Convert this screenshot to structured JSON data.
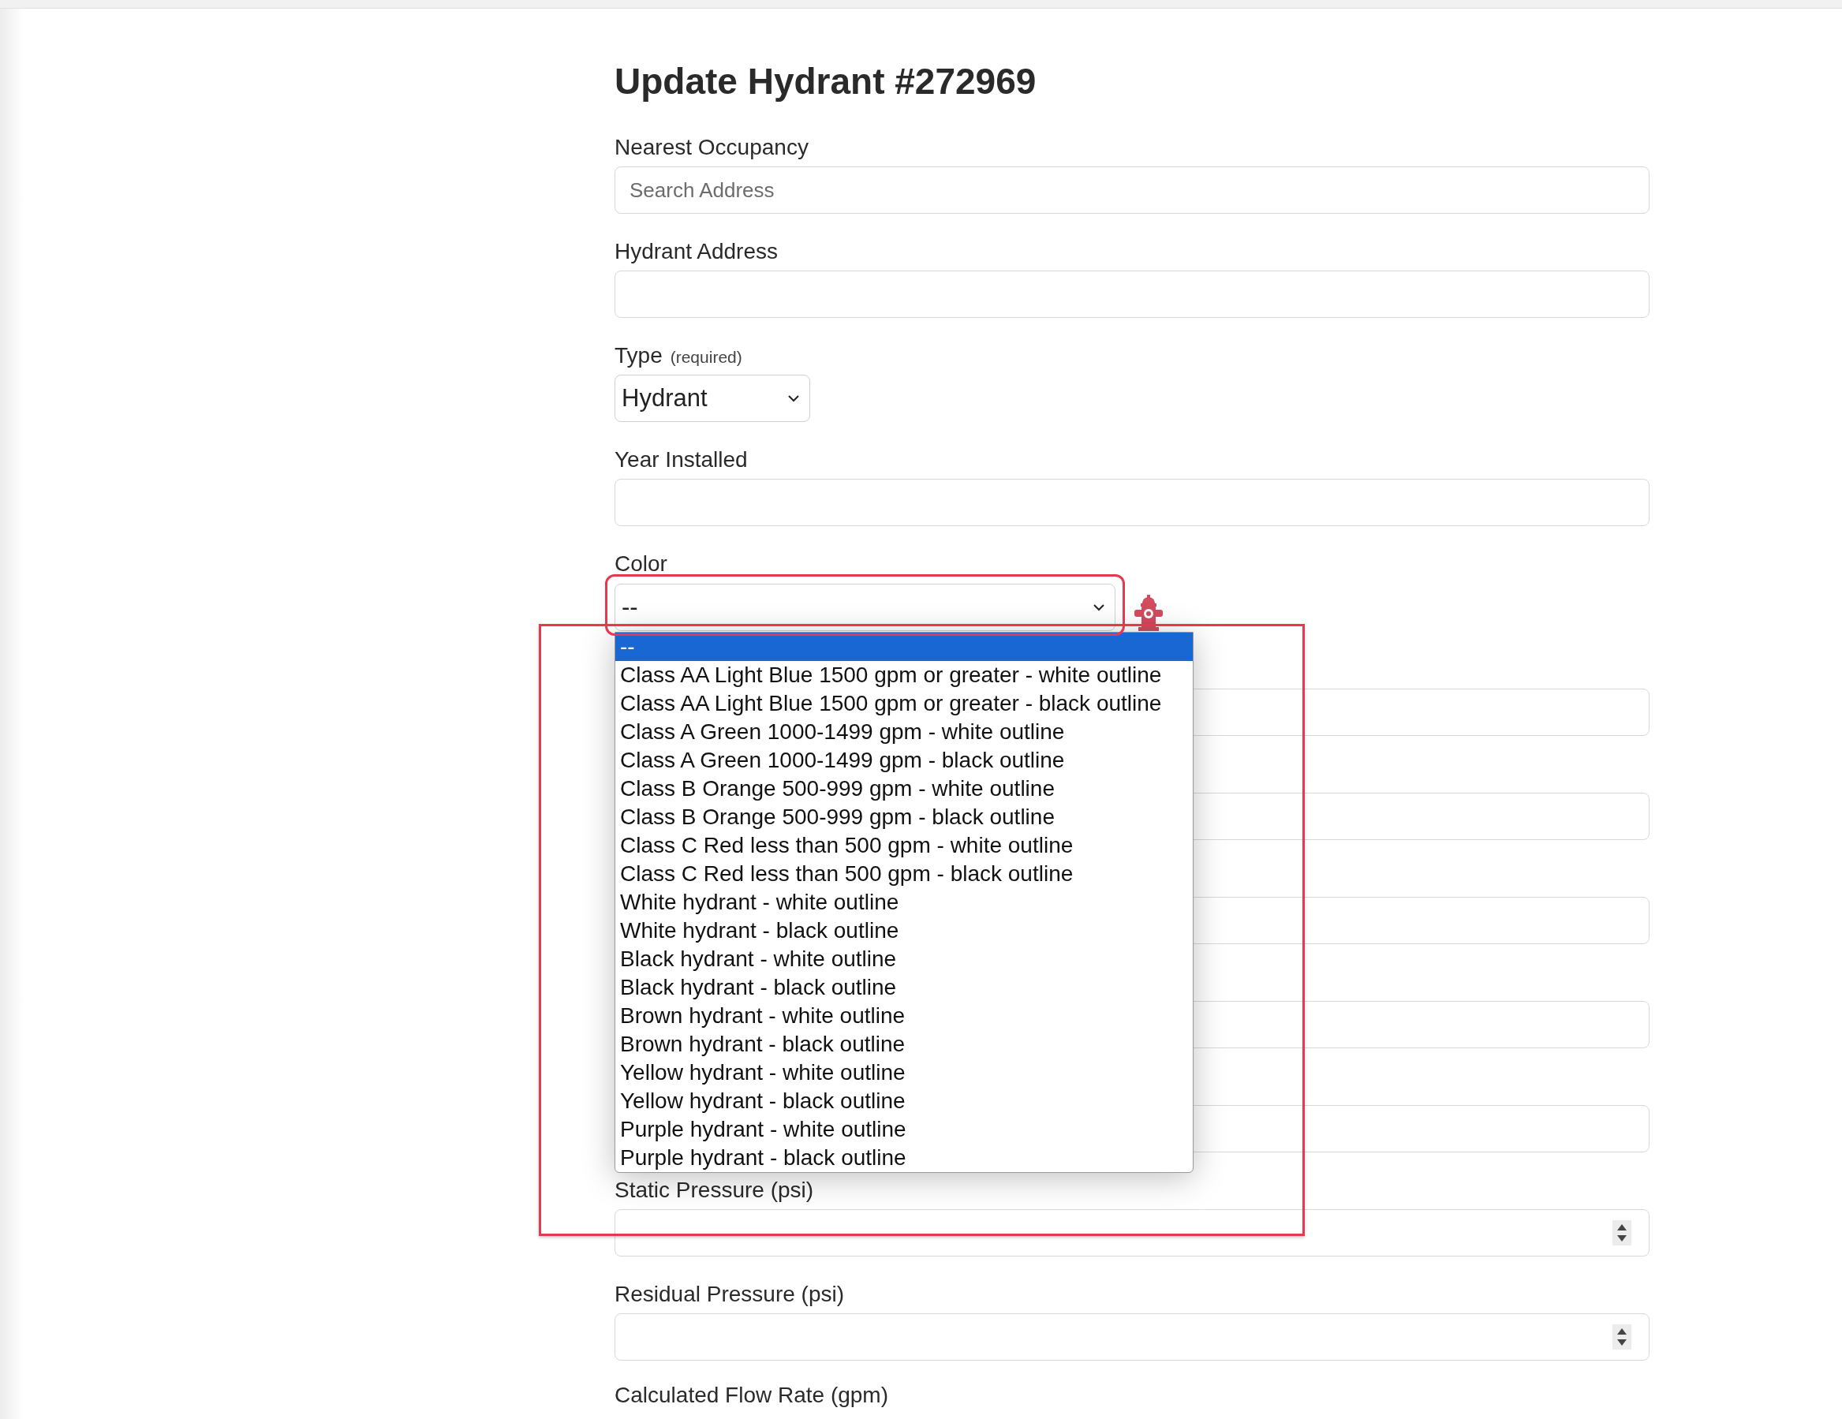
{
  "title": "Update Hydrant #272969",
  "fields": [
    {
      "kind": "text",
      "label": "Nearest Occupancy",
      "placeholder": "Search Address"
    },
    {
      "kind": "text",
      "label": "Hydrant Address"
    },
    {
      "kind": "select",
      "label": "Type",
      "note": "(required)",
      "value": "Hydrant"
    },
    {
      "kind": "text",
      "label": "Year Installed"
    },
    {
      "kind": "dropdown",
      "label": "Color",
      "value": "--",
      "open": true,
      "options": [
        {
          "label": "--",
          "selected": true
        },
        {
          "label": "Class AA Light Blue 1500 gpm or greater - white outline",
          "selected": false
        },
        {
          "label": "Class AA Light Blue 1500 gpm or greater - black outline",
          "selected": false
        },
        {
          "label": "Class A Green 1000-1499 gpm - white outline",
          "selected": false
        },
        {
          "label": "Class A Green 1000-1499 gpm - black outline",
          "selected": false
        },
        {
          "label": "Class B Orange 500-999 gpm - white outline",
          "selected": false
        },
        {
          "label": "Class B Orange 500-999 gpm - black outline",
          "selected": false
        },
        {
          "label": "Class C Red less than 500 gpm - white outline",
          "selected": false
        },
        {
          "label": "Class C Red less than 500 gpm - black outline",
          "selected": false
        },
        {
          "label": "White hydrant - white outline",
          "selected": false
        },
        {
          "label": "White hydrant - black outline",
          "selected": false
        },
        {
          "label": "Black hydrant - white outline",
          "selected": false
        },
        {
          "label": "Black hydrant - black outline",
          "selected": false
        },
        {
          "label": "Brown hydrant - white outline",
          "selected": false
        },
        {
          "label": "Brown hydrant - black outline",
          "selected": false
        },
        {
          "label": "Yellow hydrant - white outline",
          "selected": false
        },
        {
          "label": "Yellow hydrant - black outline",
          "selected": false
        },
        {
          "label": "Purple hydrant - white outline",
          "selected": false
        },
        {
          "label": "Purple hydrant - black outline",
          "selected": false
        }
      ]
    },
    {
      "kind": "text"
    },
    {
      "kind": "text"
    },
    {
      "kind": "text"
    },
    {
      "kind": "text"
    },
    {
      "kind": "text"
    },
    {
      "kind": "number",
      "label": "Static Pressure (psi)"
    },
    {
      "kind": "number",
      "label": "Residual Pressure (psi)"
    },
    {
      "kind": "label",
      "label": "Calculated Flow Rate (gpm)"
    }
  ]
}
